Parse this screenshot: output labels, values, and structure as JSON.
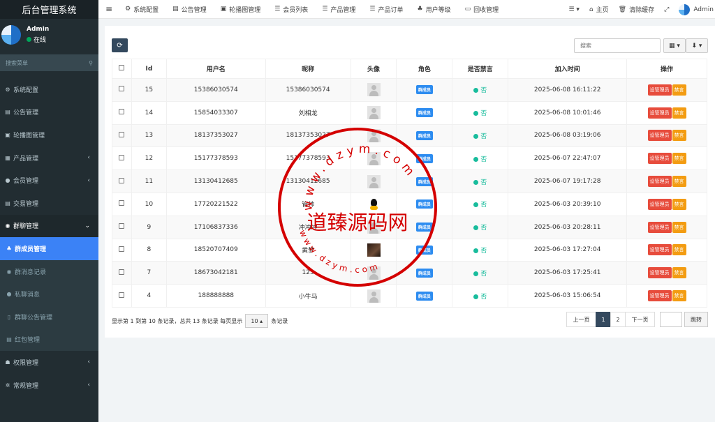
{
  "brand": "后台管理系统",
  "user": {
    "name": "Admin",
    "status": "在线"
  },
  "sidebar": {
    "search_placeholder": "搜索菜单",
    "items": [
      {
        "label": "系统配置",
        "icon": "gear-icon",
        "glyph": "⚙"
      },
      {
        "label": "公告管理",
        "icon": "file-icon",
        "glyph": "▤"
      },
      {
        "label": "轮播图管理",
        "icon": "image-icon",
        "glyph": "▣"
      },
      {
        "label": "产品管理",
        "icon": "grid-icon",
        "glyph": "▦",
        "arrow": "‹"
      },
      {
        "label": "会员管理",
        "icon": "user-icon",
        "glyph": "●",
        "arrow": "‹"
      },
      {
        "label": "交易管理",
        "icon": "list-icon",
        "glyph": "▤"
      },
      {
        "label": "群聊管理",
        "icon": "chat-icon",
        "glyph": "◉",
        "arrow": "⌄"
      },
      {
        "label": "群成员管理",
        "icon": "sitemap-icon",
        "glyph": "♣"
      },
      {
        "label": "群消息记录",
        "icon": "comment-icon",
        "glyph": "◉"
      },
      {
        "label": "私聊消息",
        "icon": "comment-icon",
        "glyph": "●"
      },
      {
        "label": "群聊公告管理",
        "icon": "bookmark-icon",
        "glyph": "▯"
      },
      {
        "label": "红包管理",
        "icon": "file-icon",
        "glyph": "▤"
      },
      {
        "label": "权限管理",
        "icon": "users-icon",
        "glyph": "☗",
        "arrow": "‹"
      },
      {
        "label": "常规管理",
        "icon": "cogs-icon",
        "glyph": "✲",
        "arrow": "‹"
      }
    ]
  },
  "topbar": {
    "tabs": [
      {
        "label": "系统配置",
        "glyph": "⚙"
      },
      {
        "label": "公告管理",
        "glyph": "▤"
      },
      {
        "label": "轮播图管理",
        "glyph": "▣"
      },
      {
        "label": "会员列表",
        "glyph": "☰"
      },
      {
        "label": "产品管理",
        "glyph": "☰"
      },
      {
        "label": "产品订单",
        "glyph": "☰"
      },
      {
        "label": "用户等级",
        "glyph": "♣"
      },
      {
        "label": "回收管理",
        "glyph": "▭"
      }
    ],
    "home": "主页",
    "clear_cache": "清除缓存",
    "admin": "Admin"
  },
  "toolbar": {
    "search_placeholder": "搜索"
  },
  "table": {
    "headers": [
      "Id",
      "用户名",
      "昵称",
      "头像",
      "角色",
      "是否禁言",
      "加入时间",
      "操作"
    ],
    "role_label": "群成员",
    "banned_label": "否",
    "set_admin_label": "设管理员",
    "mute_label": "禁言",
    "rows": [
      {
        "id": "15",
        "username": "15386030574",
        "nickname": "15386030574",
        "avatar": "default",
        "time": "2025-06-08 16:11:22"
      },
      {
        "id": "14",
        "username": "15854033307",
        "nickname": "刘相龙",
        "avatar": "default",
        "time": "2025-06-08 10:01:46"
      },
      {
        "id": "13",
        "username": "18137353027",
        "nickname": "18137353027",
        "avatar": "default",
        "time": "2025-06-08 03:19:06"
      },
      {
        "id": "12",
        "username": "15177378593",
        "nickname": "15177378593",
        "avatar": "default",
        "time": "2025-06-07 22:47:07"
      },
      {
        "id": "11",
        "username": "13130412685",
        "nickname": "13130412685",
        "avatar": "default",
        "time": "2025-06-07 19:17:28"
      },
      {
        "id": "10",
        "username": "17720221522",
        "nickname": "管帅",
        "avatar": "qq",
        "time": "2025-06-03 20:39:10"
      },
      {
        "id": "9",
        "username": "17106837336",
        "nickname": "冲冲冲",
        "avatar": "default",
        "time": "2025-06-03 20:28:11"
      },
      {
        "id": "8",
        "username": "18520707409",
        "nickname": "黄梦",
        "avatar": "photo",
        "time": "2025-06-03 17:27:04"
      },
      {
        "id": "7",
        "username": "18673042181",
        "nickname": "123",
        "avatar": "default",
        "time": "2025-06-03 17:25:41"
      },
      {
        "id": "4",
        "username": "188888888",
        "nickname": "小牛马",
        "avatar": "default",
        "time": "2025-06-03 15:06:54"
      }
    ]
  },
  "pager": {
    "info_before": "显示第 1 到第 10 条记录，总共 13 条记录 每页显示",
    "page_size": "10",
    "info_after": "条记录",
    "prev": "上一页",
    "pages": [
      "1",
      "2"
    ],
    "next": "下一页",
    "jump": "跳转"
  },
  "watermark": {
    "center_text": "道臻源码网",
    "top_text": "www.dzym.com",
    "bottom_text": "www.dzym.com",
    "color": "#d40000"
  }
}
